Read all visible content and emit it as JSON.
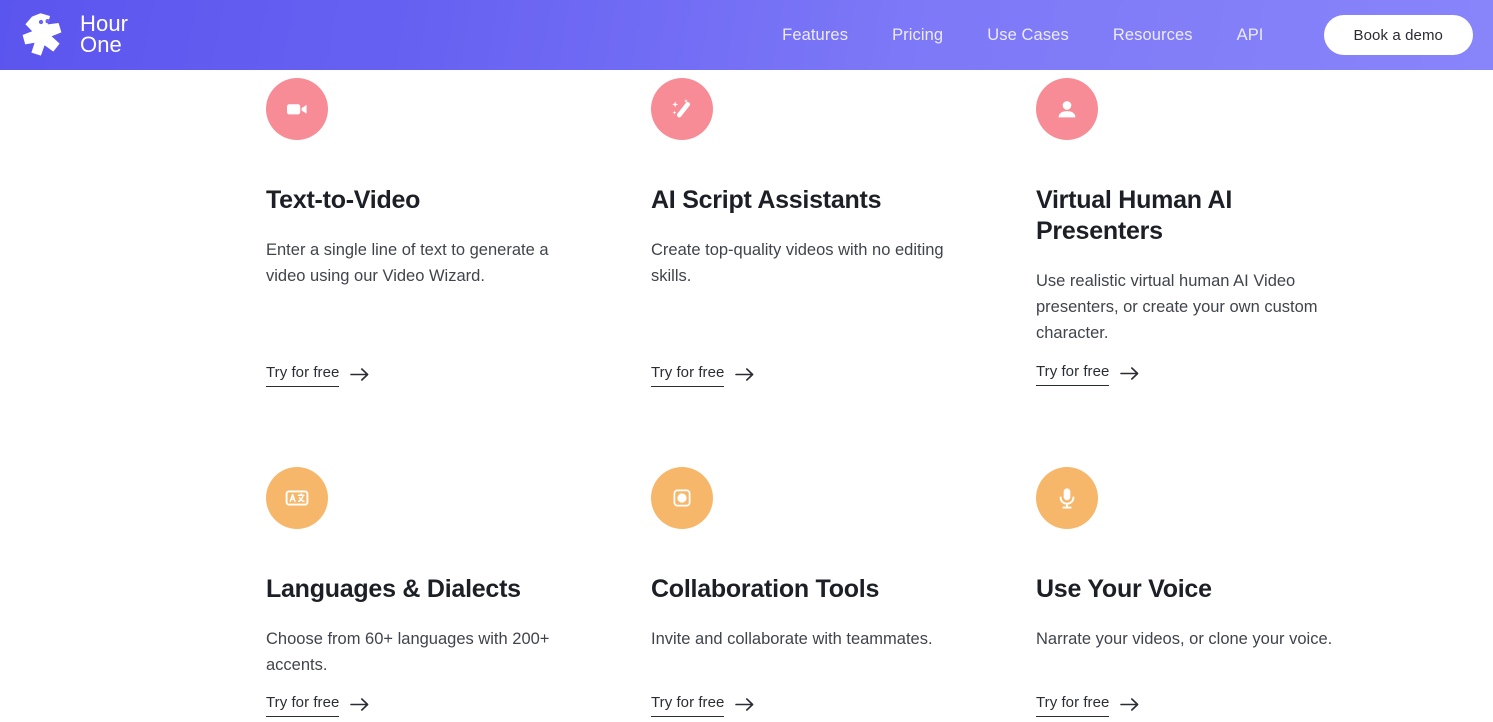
{
  "header": {
    "logo": {
      "name": "Hour One",
      "wordmark_line1": "Hour",
      "wordmark_line2": "One",
      "icon": "hour-one-star-logo"
    },
    "nav_items": [
      {
        "label": "Features"
      },
      {
        "label": "Pricing"
      },
      {
        "label": "Use Cases"
      },
      {
        "label": "Resources"
      },
      {
        "label": "API"
      }
    ],
    "cta": {
      "label": "Book a demo"
    },
    "colors": {
      "gradient_start": "#5b55ef",
      "gradient_end": "#8884fa",
      "nav_text": "#eceafe",
      "cta_bg": "#ffffff",
      "cta_text": "#2b2b33"
    }
  },
  "features": {
    "link_label": "Try for free",
    "link_icon": "arrow-right-icon",
    "colors": {
      "icon_pink": "#f88c96",
      "icon_orange": "#f7b76b",
      "title": "#1d1f26",
      "body": "#41444d"
    },
    "cards": [
      {
        "title": "Text-to-Video",
        "description": "Enter a single line of text to generate a video using our Video Wizard.",
        "icon": "video-camera-icon",
        "icon_color": "#f88c96",
        "link_label": "Try for free"
      },
      {
        "title": "AI Script Assistants",
        "description": "Create top-quality videos with no editing skills.",
        "icon": "magic-wand-icon",
        "icon_color": "#f88c96",
        "link_label": "Try for free"
      },
      {
        "title": "Virtual Human AI Presenters",
        "description": "Use realistic virtual human AI Video presenters, or create your own custom character.",
        "icon": "person-icon",
        "icon_color": "#f88c96",
        "link_label": "Try for free"
      },
      {
        "title": "Languages & Dialects",
        "description": "Choose from 60+ languages with 200+ accents.",
        "icon": "translate-icon",
        "icon_color": "#f7b76b",
        "link_label": "Try for free"
      },
      {
        "title": "Collaboration Tools",
        "description": "Invite and collaborate with teammates.",
        "icon": "frame-circle-icon",
        "icon_color": "#f7b76b",
        "link_label": "Try for free"
      },
      {
        "title": "Use Your Voice",
        "description": "Narrate your videos, or clone  your voice.",
        "icon": "microphone-icon",
        "icon_color": "#f7b76b",
        "link_label": "Try for free"
      }
    ]
  }
}
